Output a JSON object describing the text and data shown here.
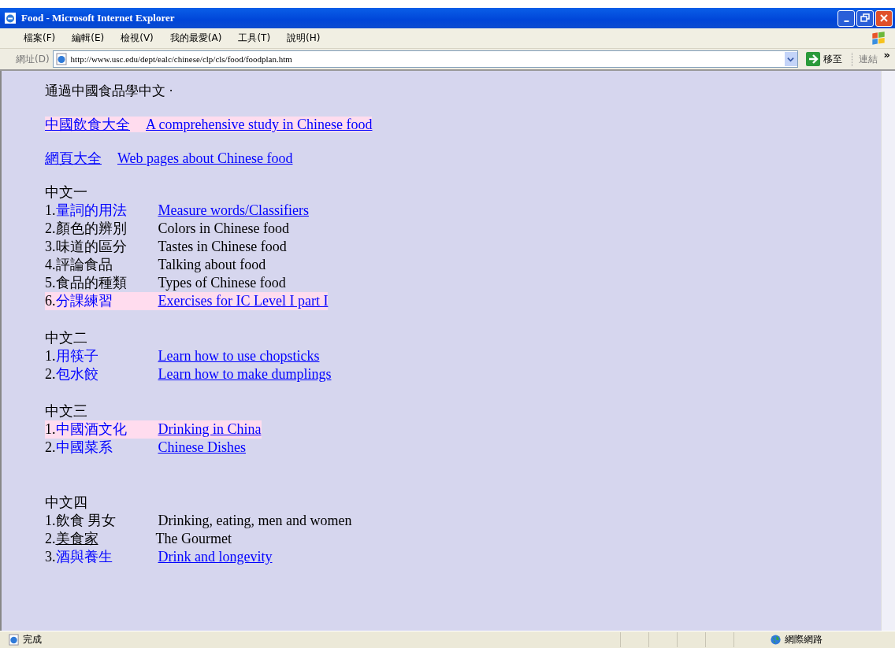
{
  "window": {
    "title": "Food - Microsoft Internet Explorer"
  },
  "menu": [
    "檔案(F)",
    "編輯(E)",
    "檢視(V)",
    "我的最愛(A)",
    "工具(T)",
    "說明(H)"
  ],
  "address_bar": {
    "label": "網址(D)",
    "value": "http://www.usc.edu/dept/ealc/chinese/clp/cls/food/foodplan.htm",
    "go_button": "移至",
    "links": "連結",
    "more": "»"
  },
  "page": {
    "intro": "通過中國食品學中文 ·",
    "top_links": [
      {
        "chinese": "中國飲食大全",
        "english": "A comprehensive study in Chinese food",
        "highlighted": true
      },
      {
        "chinese": "網頁大全",
        "english": "Web pages about Chinese food",
        "highlighted": false
      }
    ],
    "sections": [
      {
        "heading": "中文一",
        "items": [
          {
            "number": "1.",
            "chinese": "量詞的用法",
            "english": "Measure words/Classifiers",
            "kind": "link",
            "highlighted": false
          },
          {
            "number": "2.",
            "chinese": "顏色的辨別",
            "english": "Colors in Chinese food",
            "kind": "plain",
            "highlighted": false
          },
          {
            "number": "3.",
            "chinese": "味道的區分",
            "english": "Tastes in Chinese food",
            "kind": "plain",
            "highlighted": false
          },
          {
            "number": "4.",
            "chinese": "評論食品",
            "english": "Talking about food",
            "kind": "plain",
            "highlighted": false
          },
          {
            "number": "5.",
            "chinese": "食品的種類",
            "english": "Types of Chinese food",
            "kind": "plain",
            "highlighted": false
          },
          {
            "number": "6.",
            "chinese": "分課練習",
            "english": "Exercises for IC Level I part I",
            "kind": "link",
            "highlighted": true
          }
        ]
      },
      {
        "heading": "中文二",
        "items": [
          {
            "number": "1.",
            "chinese": "用筷子",
            "english": "Learn how to use chopsticks",
            "kind": "link",
            "highlighted": false
          },
          {
            "number": "2.",
            "chinese": "包水餃",
            "english": "Learn how to make dumplings",
            "kind": "link",
            "highlighted": false
          }
        ]
      },
      {
        "heading": "中文三",
        "items": [
          {
            "number": "1.",
            "chinese": "中國酒文化",
            "english": "Drinking in China",
            "kind": "link",
            "highlighted": true
          },
          {
            "number": "2.",
            "chinese": "中國菜系",
            "english": "Chinese Dishes",
            "kind": "link",
            "highlighted": false
          }
        ]
      },
      {
        "heading": "中文四",
        "items": [
          {
            "number": "1.",
            "chinese": "飲食 男女",
            "english": "Drinking, eating, men and women",
            "kind": "plain",
            "highlighted": false
          },
          {
            "number": "2.",
            "chinese": "美食家",
            "english": "The Gourmet",
            "kind": "underlined",
            "highlighted": false
          },
          {
            "number": "3.",
            "chinese": "酒與養生",
            "english": "Drink and longevity",
            "kind": "link",
            "highlighted": false
          }
        ]
      }
    ]
  },
  "status_bar": {
    "status": "完成",
    "zone": "網際網路"
  }
}
